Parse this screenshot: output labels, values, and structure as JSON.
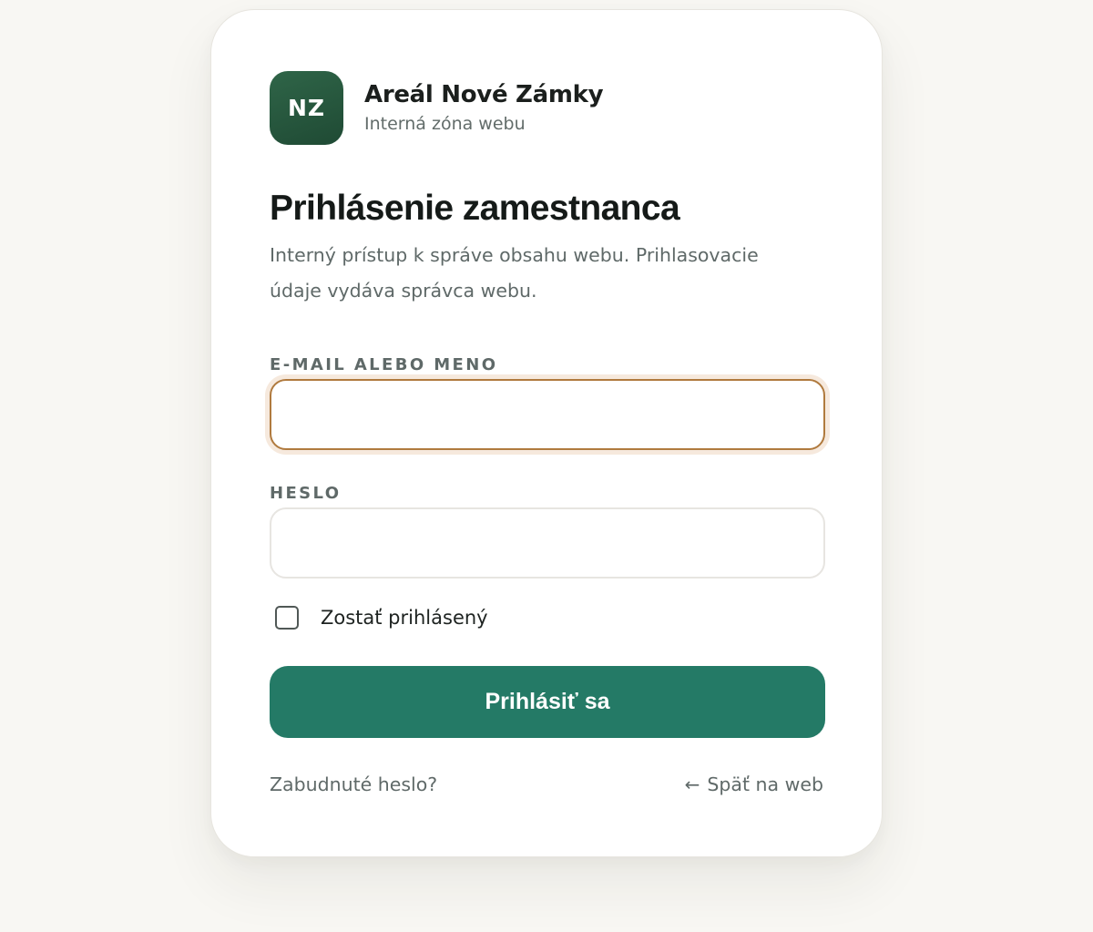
{
  "brand": {
    "logo_initials": "NZ",
    "name": "Areál Nové Zámky",
    "subtitle": "Interná zóna webu"
  },
  "login": {
    "title": "Prihlásenie zamestnanca",
    "description": "Interný prístup k správe obsahu webu. Prihlasovacie údaje vydáva správca webu.",
    "email_label": "E-MAIL ALEBO MENO",
    "email_value": "",
    "password_label": "HESLO",
    "password_value": "",
    "remember_label": "Zostať prihlásený",
    "remember_checked": false,
    "submit_label": "Prihlásiť sa",
    "forgot_link": "Zabudnuté heslo?",
    "back_arrow": "←",
    "back_link": "Späť na web"
  },
  "colors": {
    "page_background": "#f8f7f3",
    "accent_green": "#247a66",
    "logo_green": "#245840",
    "focus_border": "#b07a3e",
    "focus_ring": "#f6e9dd",
    "text_dark": "#151a18",
    "text_muted": "#5f6968"
  },
  "icons": {
    "back": "arrow-left-icon"
  }
}
